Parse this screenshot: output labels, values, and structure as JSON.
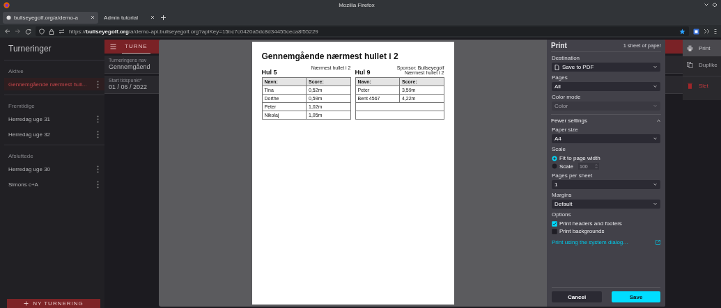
{
  "browser": {
    "window_title": "Mozilla Firefox",
    "tabs": [
      {
        "label": "bullseyegolf.org/a/demo-a",
        "selected": true,
        "favicon": true
      },
      {
        "label": "Admin tutorial",
        "selected": false,
        "favicon": false
      }
    ],
    "url": "https://**bullseyegolf.org**/a/demo-api.bullseyegolf.org?apiKey=15bc7c0420a5dc8d34455ceca8f55229"
  },
  "sidebar": {
    "title": "Turneringer",
    "sections": [
      {
        "heading": "Aktive",
        "items": [
          {
            "label": "Gennemgående nærmest hull...",
            "selected": true
          }
        ]
      },
      {
        "heading": "Fremtidige",
        "items": [
          {
            "label": "Herredag uge 31",
            "selected": false
          },
          {
            "label": "Herredag uge 32",
            "selected": false
          }
        ]
      },
      {
        "heading": "Afsluttede",
        "items": [
          {
            "label": "Herredag uge 30",
            "selected": false
          },
          {
            "label": "Simons c+A",
            "selected": false
          }
        ]
      }
    ],
    "new_button": "NY TURNERING"
  },
  "app_bar": {
    "tab": "TURNE"
  },
  "form": {
    "fields": [
      {
        "label": "Turneringens nav",
        "value": "Gennemgåend"
      },
      {
        "label": "Start tidspunkt*",
        "value": "01 / 06 / 2022"
      }
    ]
  },
  "context_menu": [
    {
      "label": "Print",
      "kind": "print",
      "selected": true
    },
    {
      "label": "Duplike",
      "kind": "duplicate",
      "selected": false
    },
    {
      "label": "Slet",
      "kind": "delete",
      "selected": false
    }
  ],
  "print_preview": {
    "title": "Gennemgående nærmest hullet i 2",
    "holes": [
      {
        "name": "Hul 5",
        "notes": [
          "Nærmest hullet i 2"
        ],
        "columns": [
          "Navn:",
          "Score:"
        ],
        "rows": [
          [
            "Tina",
            "0,52m"
          ],
          [
            "Dorthe",
            "0,59m"
          ],
          [
            "Peter",
            "1,02m"
          ],
          [
            "Nikolaj",
            "1,05m"
          ]
        ]
      },
      {
        "name": "Hul 9",
        "notes": [
          "Sponsor: Bullseyegolf",
          "Nærmest hullet i 2"
        ],
        "columns": [
          "Navn:",
          "Score:"
        ],
        "rows": [
          [
            "Peter",
            "3,59m"
          ],
          [
            "Bent 4567",
            "4,22m"
          ]
        ]
      }
    ]
  },
  "print_panel": {
    "title": "Print",
    "sheets": "1 sheet of paper",
    "settings": [
      {
        "kind": "select",
        "label": "Destination",
        "value": "Save to PDF",
        "disabled": false,
        "file_icon": true
      },
      {
        "kind": "select",
        "label": "Pages",
        "value": "All",
        "disabled": false
      },
      {
        "kind": "select",
        "label": "Color mode",
        "value": "Color",
        "disabled": true
      },
      {
        "kind": "toggle",
        "label": "Fewer settings",
        "expanded": true
      },
      {
        "kind": "select",
        "label": "Paper size",
        "value": "A4",
        "disabled": false
      },
      {
        "kind": "radios",
        "label": "Scale",
        "options": [
          {
            "label": "Fit to page width",
            "selected": true
          },
          {
            "label": "Scale",
            "selected": false,
            "value": "100"
          }
        ]
      },
      {
        "kind": "select",
        "label": "Pages per sheet",
        "value": "1",
        "disabled": false
      },
      {
        "kind": "select",
        "label": "Margins",
        "value": "Default",
        "disabled": false
      },
      {
        "kind": "checks",
        "label": "Options",
        "options": [
          {
            "label": "Print headers and footers",
            "checked": true
          },
          {
            "label": "Print backgrounds",
            "checked": false
          }
        ]
      },
      {
        "kind": "link",
        "label": "Print using the system dialog…"
      }
    ],
    "buttons": [
      {
        "label": "Cancel",
        "primary": false
      },
      {
        "label": "Save",
        "primary": true
      }
    ]
  }
}
